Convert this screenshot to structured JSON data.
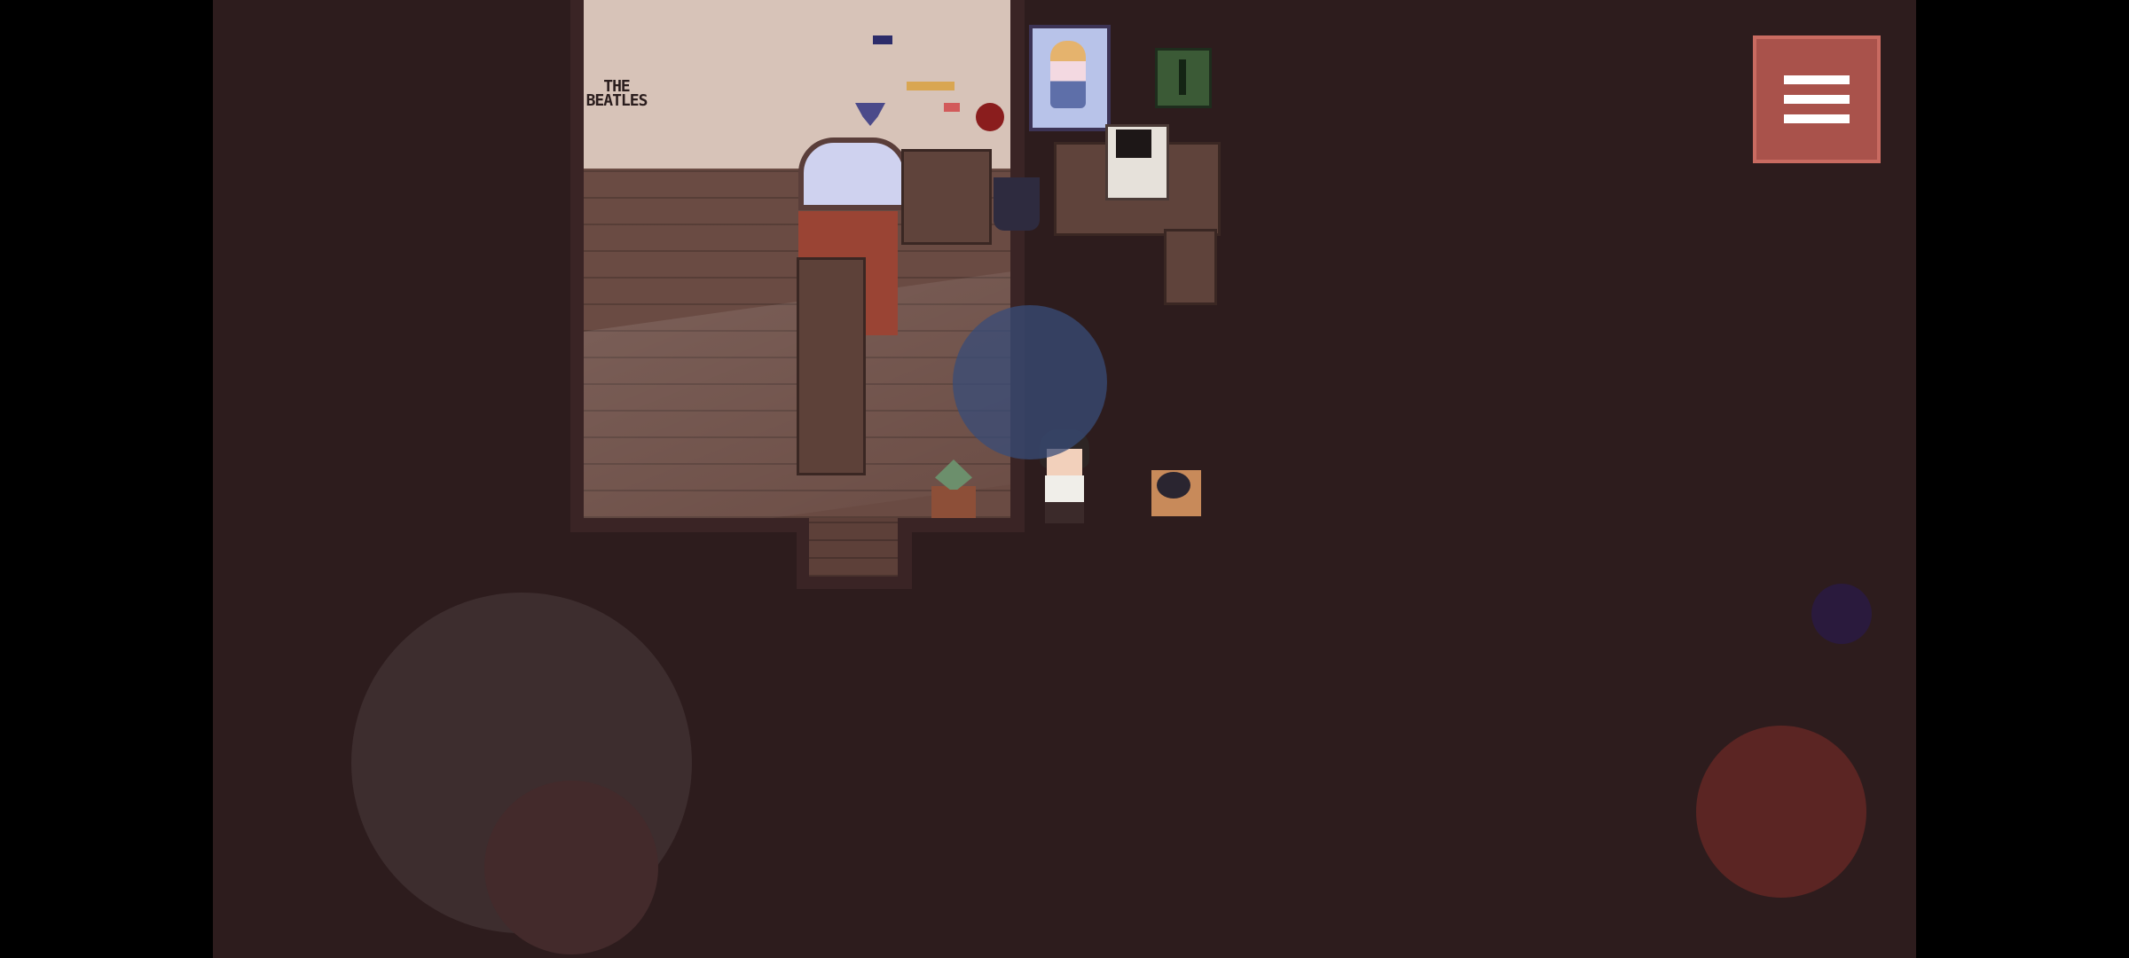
{
  "scene": {
    "wall_sign_text": "THE\nBEATLES",
    "colors": {
      "background": "#2d1c1d",
      "wall": "#d7c3b8",
      "floor": "#6a4b43",
      "menu_button": "#a9524b",
      "action_button": "#5b2523",
      "secondary_button": "#2a1a3d",
      "joystick": "#3d2d2e"
    }
  },
  "hud": {
    "menu_icon": "hamburger-menu-icon",
    "joystick_icon": "virtual-joystick",
    "action_icon": "action-button",
    "secondary_icon": "secondary-button"
  }
}
